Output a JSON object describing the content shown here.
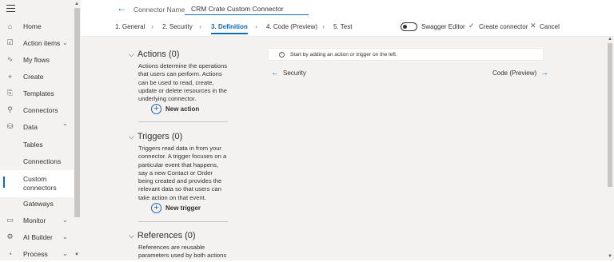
{
  "nav": {
    "items": [
      {
        "icon": "home-icon",
        "glyph": "⌂",
        "label": "Home",
        "chevron": ""
      },
      {
        "icon": "action-items-icon",
        "glyph": "☑",
        "label": "Action items",
        "chevron": "⌄"
      },
      {
        "icon": "my-flows-icon",
        "glyph": "∿",
        "label": "My flows",
        "chevron": ""
      },
      {
        "icon": "create-icon",
        "glyph": "+",
        "label": "Create",
        "chevron": ""
      },
      {
        "icon": "templates-icon",
        "glyph": "⎘",
        "label": "Templates",
        "chevron": ""
      },
      {
        "icon": "connectors-icon",
        "glyph": "⚲",
        "label": "Connectors",
        "chevron": ""
      },
      {
        "icon": "data-icon",
        "glyph": "⛁",
        "label": "Data",
        "chevron": "⌃"
      },
      {
        "label": "Tables"
      },
      {
        "label": "Connections"
      },
      {
        "label": "Custom connectors"
      },
      {
        "label": "Gateways"
      },
      {
        "icon": "monitor-icon",
        "glyph": "▭",
        "label": "Monitor",
        "chevron": "⌄"
      },
      {
        "icon": "ai-builder-icon",
        "glyph": "⚙",
        "label": "AI Builder",
        "chevron": "⌄"
      },
      {
        "icon": "process-icon",
        "glyph": "◔",
        "label": "Process",
        "chevron": "⌄"
      }
    ]
  },
  "topbar": {
    "connector_label": "Connector Name",
    "connector_value": "CRM Crate Custom Connector",
    "steps": [
      "1. General",
      "2. Security",
      "3. Definition",
      "4. Code (Preview)",
      "5. Test"
    ],
    "active_step": "3. Definition",
    "swagger_label": "Swagger Editor",
    "swagger_on": false,
    "create_label": "Create connector",
    "cancel_label": "Cancel"
  },
  "panel": {
    "actions_title": "Actions (0)",
    "actions_desc": "Actions determine the operations that users can perform. Actions can be used to read, create, update or delete resources in the underlying connector.",
    "new_action": "New action",
    "triggers_title": "Triggers (0)",
    "triggers_desc": "Triggers read data in from your connector. A trigger focuses on a particular event that happens, say a new Contact or Order being created and provides the relevant data so that users can take action on that event.",
    "new_trigger": "New trigger",
    "references_title": "References (0)",
    "references_desc": "References are reusable parameters used by both actions"
  },
  "content": {
    "info_text": "Start by adding an action or trigger on the left.",
    "prev_link": "Security",
    "next_link": "Code (Preview)"
  },
  "colors": {
    "accent": "#0f6cbd",
    "nav_bg": "#f3f2f1"
  }
}
